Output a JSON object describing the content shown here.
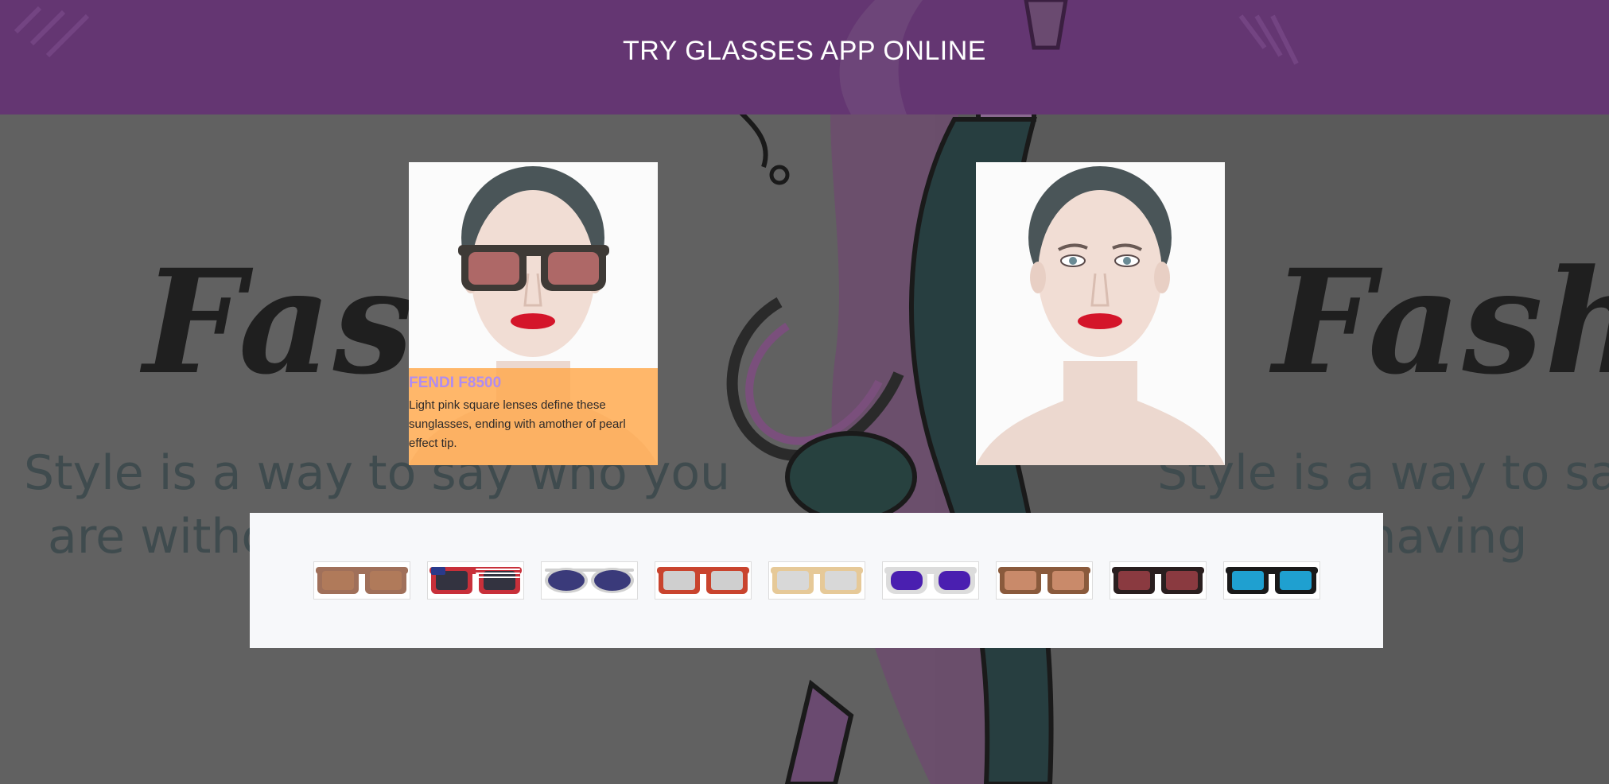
{
  "header": {
    "title": "TRY GLASSES APP ONLINE"
  },
  "background": {
    "word_left": "Fash",
    "word_right": "Fashio",
    "slogan_left_line1": "Style is a way to say who you",
    "slogan_left_line2": "are witho",
    "slogan_right_line1": "Style is a way to say",
    "slogan_right_line2": "out having"
  },
  "preview": {
    "product_name": "FENDI F8500",
    "product_description": "Light pink square lenses define these sunglasses, ending with amother of pearl effect tip."
  },
  "glasses": [
    {
      "name": "glasses-1",
      "frame": "#a0705a",
      "lens": "#b07a5a",
      "style": "square"
    },
    {
      "name": "glasses-2",
      "frame": "#c8303a",
      "lens": "#333340",
      "style": "flag"
    },
    {
      "name": "glasses-3",
      "frame": "#d0d0d0",
      "lens": "#3a3a7a",
      "style": "aviator"
    },
    {
      "name": "glasses-4",
      "frame": "#c9442e",
      "lens": "#cfcfcf",
      "style": "square"
    },
    {
      "name": "glasses-5",
      "frame": "#e6c998",
      "lens": "#d8d8d8",
      "style": "square"
    },
    {
      "name": "glasses-6",
      "frame": "#dcdcdc",
      "lens": "#4a1fb0",
      "style": "round"
    },
    {
      "name": "glasses-7",
      "frame": "#8a5a3c",
      "lens": "#c98a6a",
      "style": "square"
    },
    {
      "name": "glasses-8",
      "frame": "#2a1f1f",
      "lens": "#8a3a40",
      "style": "square"
    },
    {
      "name": "glasses-9",
      "frame": "#1a1a1a",
      "lens": "#1fa0d0",
      "style": "square"
    }
  ],
  "colors": {
    "header_bg": "#643672",
    "info_panel_bg": "#ffaa50",
    "product_name": "#b08cf0"
  }
}
